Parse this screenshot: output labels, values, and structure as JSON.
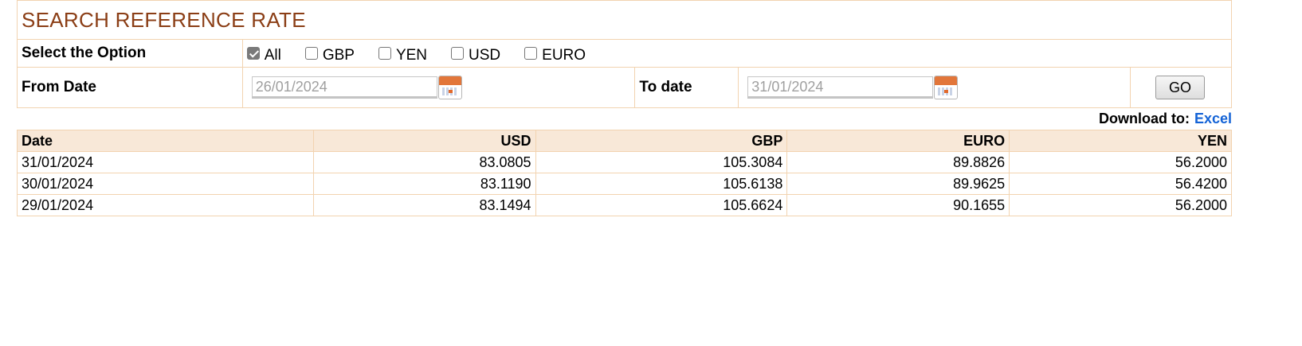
{
  "form": {
    "title": "SEARCH REFERENCE RATE",
    "option_label": "Select the Option",
    "options": [
      {
        "label": "All",
        "checked": true
      },
      {
        "label": "GBP",
        "checked": false
      },
      {
        "label": "YEN",
        "checked": false
      },
      {
        "label": "USD",
        "checked": false
      },
      {
        "label": "EURO",
        "checked": false
      }
    ],
    "from_label": "From Date",
    "from_value": "26/01/2024",
    "to_label": "To date",
    "to_value": "31/01/2024",
    "go_label": "GO",
    "calendar_icon": "calendar-icon"
  },
  "download": {
    "label": "Download to:",
    "link": "Excel"
  },
  "table": {
    "headers": [
      "Date",
      "USD",
      "GBP",
      "EURO",
      "YEN"
    ],
    "rows": [
      [
        "31/01/2024",
        "83.0805",
        "105.3084",
        "89.8826",
        "56.2000"
      ],
      [
        "30/01/2024",
        "83.1190",
        "105.6138",
        "89.9625",
        "56.4200"
      ],
      [
        "29/01/2024",
        "83.1494",
        "105.6624",
        "90.1655",
        "56.2000"
      ]
    ]
  },
  "colors": {
    "title": "#8b3e16",
    "border": "#f2d3b0",
    "header_bg": "#f8e8d8",
    "link": "#1463d6"
  }
}
